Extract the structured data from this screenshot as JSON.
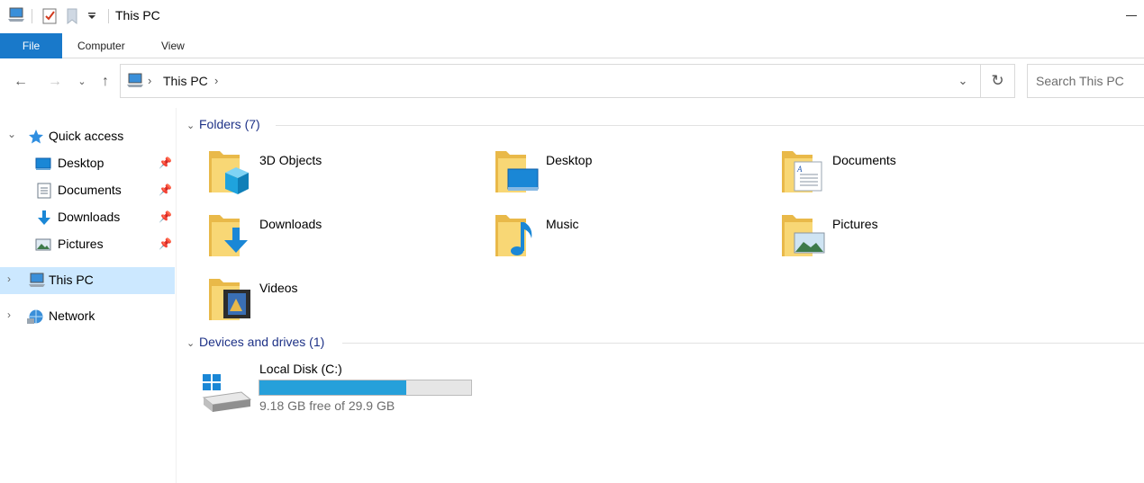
{
  "window": {
    "title": "This PC"
  },
  "ribbon": {
    "tabs": [
      "File",
      "Computer",
      "View"
    ]
  },
  "address": {
    "path": [
      "This PC"
    ],
    "search_placeholder": "Search This PC"
  },
  "sidebar": {
    "quick_access": {
      "label": "Quick access",
      "items": [
        {
          "label": "Desktop",
          "icon": "desktop-icon",
          "pinned": true
        },
        {
          "label": "Documents",
          "icon": "documents-icon",
          "pinned": true
        },
        {
          "label": "Downloads",
          "icon": "downloads-icon",
          "pinned": true
        },
        {
          "label": "Pictures",
          "icon": "pictures-icon",
          "pinned": true
        }
      ]
    },
    "this_pc": {
      "label": "This PC",
      "selected": true
    },
    "network": {
      "label": "Network"
    }
  },
  "content": {
    "folders": {
      "header": "Folders (7)",
      "items": [
        {
          "label": "3D Objects",
          "icon": "3d-objects-folder-icon"
        },
        {
          "label": "Desktop",
          "icon": "desktop-folder-icon"
        },
        {
          "label": "Documents",
          "icon": "documents-folder-icon"
        },
        {
          "label": "Downloads",
          "icon": "downloads-folder-icon"
        },
        {
          "label": "Music",
          "icon": "music-folder-icon"
        },
        {
          "label": "Pictures",
          "icon": "pictures-folder-icon"
        },
        {
          "label": "Videos",
          "icon": "videos-folder-icon"
        }
      ]
    },
    "devices": {
      "header": "Devices and drives (1)",
      "items": [
        {
          "label": "Local Disk (C:)",
          "free_text": "9.18 GB free of 29.9 GB",
          "used_fraction": 0.693
        }
      ]
    }
  },
  "colors": {
    "accent": "#1979ca",
    "selection": "#cce8ff",
    "group_header": "#1e3287",
    "drive_bar": "#26a0da",
    "folder": "#f8d775"
  }
}
